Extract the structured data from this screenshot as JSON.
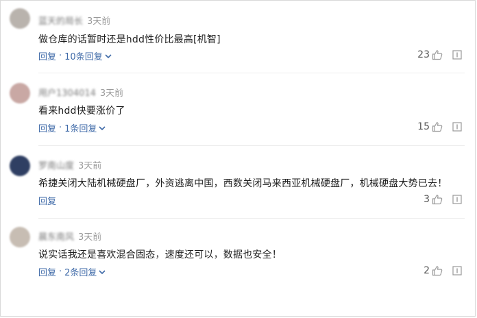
{
  "comments": [
    {
      "username": "蓝天的局长",
      "time": "3天前",
      "text": "做仓库的话暂时还是hdd性价比最高[机智]",
      "reply_label": "回复",
      "dot": "·",
      "replies_label": "10条回复",
      "likes": "23",
      "avatar_color": "#b9b3ad"
    },
    {
      "username": "用户1304014",
      "time": "3天前",
      "text": "看来hdd快要涨价了",
      "reply_label": "回复",
      "dot": "·",
      "replies_label": "1条回复",
      "likes": "15",
      "avatar_color": "#c9a8a4"
    },
    {
      "username": "罗南山度",
      "time": "3天前",
      "text": "希捷关闭大陆机械硬盘厂，外资逃离中国，西数关闭马来西亚机械硬盘厂，机械硬盘大势已去！",
      "reply_label": "回复",
      "dot": "",
      "replies_label": "",
      "likes": "3",
      "avatar_color": "#2f3f63"
    },
    {
      "username": "晨东南风",
      "time": "3天前",
      "text": "说实话我还是喜欢混合固态，速度还可以，数据也安全！",
      "reply_label": "回复",
      "dot": "·",
      "replies_label": "2条回复",
      "likes": "2",
      "avatar_color": "#c7bdb3"
    }
  ],
  "colors": {
    "link": "#3f6aa8",
    "divider": "#ececec"
  },
  "icons": {
    "like": "thumb-up-icon",
    "report": "report-icon",
    "expand": "chevron-down-icon"
  }
}
